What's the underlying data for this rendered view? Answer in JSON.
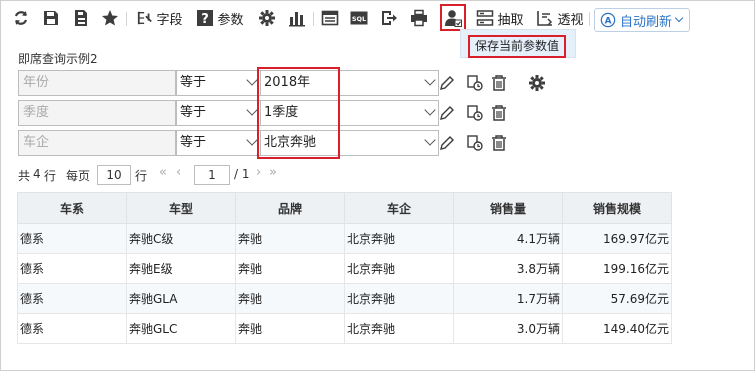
{
  "toolbar": {
    "field_label": "字段",
    "param_label": "参数",
    "extract_label": "抽取",
    "pivot_label": "透视",
    "sql_label": "SQL",
    "auto_refresh_label": "自动刷新"
  },
  "dropdown": {
    "save_params_label": "保存当前参数值"
  },
  "report": {
    "title": "即席查询示例2"
  },
  "params": [
    {
      "name": "年份",
      "operator": "等于",
      "value": "2018年"
    },
    {
      "name": "季度",
      "operator": "等于",
      "value": "1季度"
    },
    {
      "name": "车企",
      "operator": "等于",
      "value": "北京奔驰"
    }
  ],
  "pager": {
    "total_prefix": "共",
    "total": "4",
    "total_suffix": "行",
    "per_page_label": "每页",
    "per_page": "10",
    "per_page_suffix": "行",
    "current": "1",
    "total_pages": "/ 1"
  },
  "table": {
    "headers": [
      "车系",
      "车型",
      "品牌",
      "车企",
      "销售量",
      "销售规模"
    ],
    "rows": [
      [
        "德系",
        "奔驰C级",
        "奔驰",
        "北京奔驰",
        "4.1万辆",
        "169.97亿元"
      ],
      [
        "德系",
        "奔驰E级",
        "奔驰",
        "北京奔驰",
        "3.8万辆",
        "199.16亿元"
      ],
      [
        "德系",
        "奔驰GLA",
        "奔驰",
        "北京奔驰",
        "1.7万辆",
        "57.69亿元"
      ],
      [
        "德系",
        "奔驰GLC",
        "奔驰",
        "北京奔驰",
        "3.0万辆",
        "149.40亿元"
      ]
    ]
  },
  "colors": {
    "accent_blue": "#2a73c4",
    "highlight_red": "#d9202a",
    "icon_dark": "#3d3d3d"
  }
}
